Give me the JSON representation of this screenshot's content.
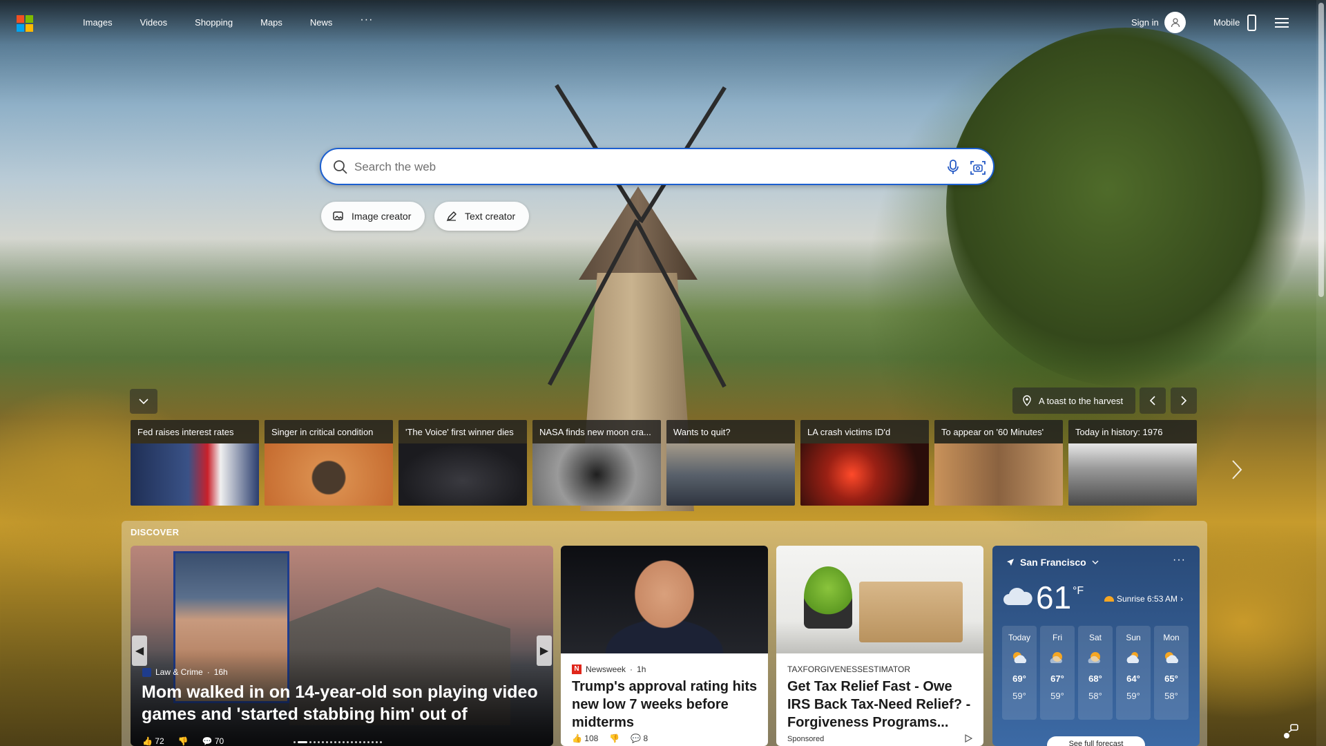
{
  "nav": {
    "items": [
      "Images",
      "Videos",
      "Shopping",
      "Maps",
      "News"
    ],
    "more": "···",
    "sign_in": "Sign in",
    "mobile": "Mobile"
  },
  "search": {
    "placeholder": "Search the web"
  },
  "chips": [
    "Image creator",
    "Text creator"
  ],
  "location_caption": "A toast to the harvest",
  "news_tiles": [
    {
      "label": "Fed raises interest rates",
      "color": "#2e4a7a"
    },
    {
      "label": "Singer in critical condition",
      "color": "#c7743a"
    },
    {
      "label": "'The Voice' first winner dies",
      "color": "#2a2a2e"
    },
    {
      "label": "NASA finds new moon cra...",
      "color": "#6c6c6c"
    },
    {
      "label": "Wants to quit?",
      "color": "#59616b"
    },
    {
      "label": "LA crash victims ID'd",
      "color": "#7a2a1a"
    },
    {
      "label": "To appear on '60 Minutes'",
      "color": "#a87a4a"
    },
    {
      "label": "Today in history: 1976",
      "color": "#8e8e8e"
    }
  ],
  "discover": {
    "title": "DISCOVER",
    "hero": {
      "source": "Law & Crime",
      "age": "16h",
      "headline": "Mom walked in on 14-year-old son playing video games and 'started stabbing him' out of nowher...",
      "likes": "72",
      "comments": "70"
    },
    "cards": [
      {
        "source": "Newsweek",
        "age": "1h",
        "title": "Trump's approval rating hits new low 7 weeks before midterms",
        "likes": "108",
        "comments": "8"
      },
      {
        "source": "TAXFORGIVENESSESTIMATOR",
        "title": "Get Tax Relief Fast - Owe IRS Back Tax-Need Relief? - Forgiveness Programs...",
        "sponsored": "Sponsored"
      }
    ]
  },
  "weather": {
    "city": "San Francisco",
    "more": "···",
    "temp": "61",
    "unit": "°F",
    "sunrise": "Sunrise 6:53 AM",
    "days": [
      {
        "name": "Today",
        "hi": "69°",
        "lo": "59°",
        "icon": "partly-sunny-icon"
      },
      {
        "name": "Fri",
        "hi": "67°",
        "lo": "59°",
        "icon": "partly-sunny-icon"
      },
      {
        "name": "Sat",
        "hi": "68°",
        "lo": "58°",
        "icon": "partly-sunny-icon"
      },
      {
        "name": "Sun",
        "hi": "64°",
        "lo": "59°",
        "icon": "cloudy-icon"
      },
      {
        "name": "Mon",
        "hi": "65°",
        "lo": "58°",
        "icon": "partly-sunny-icon"
      }
    ],
    "forecast_link": "See full forecast"
  },
  "colors": {
    "search_border": "#1b5fd0",
    "ms_red": "#f25022",
    "ms_green": "#7fba00",
    "ms_blue": "#00a4ef",
    "ms_yellow": "#ffb900",
    "newsweek_red": "#e0261b"
  }
}
